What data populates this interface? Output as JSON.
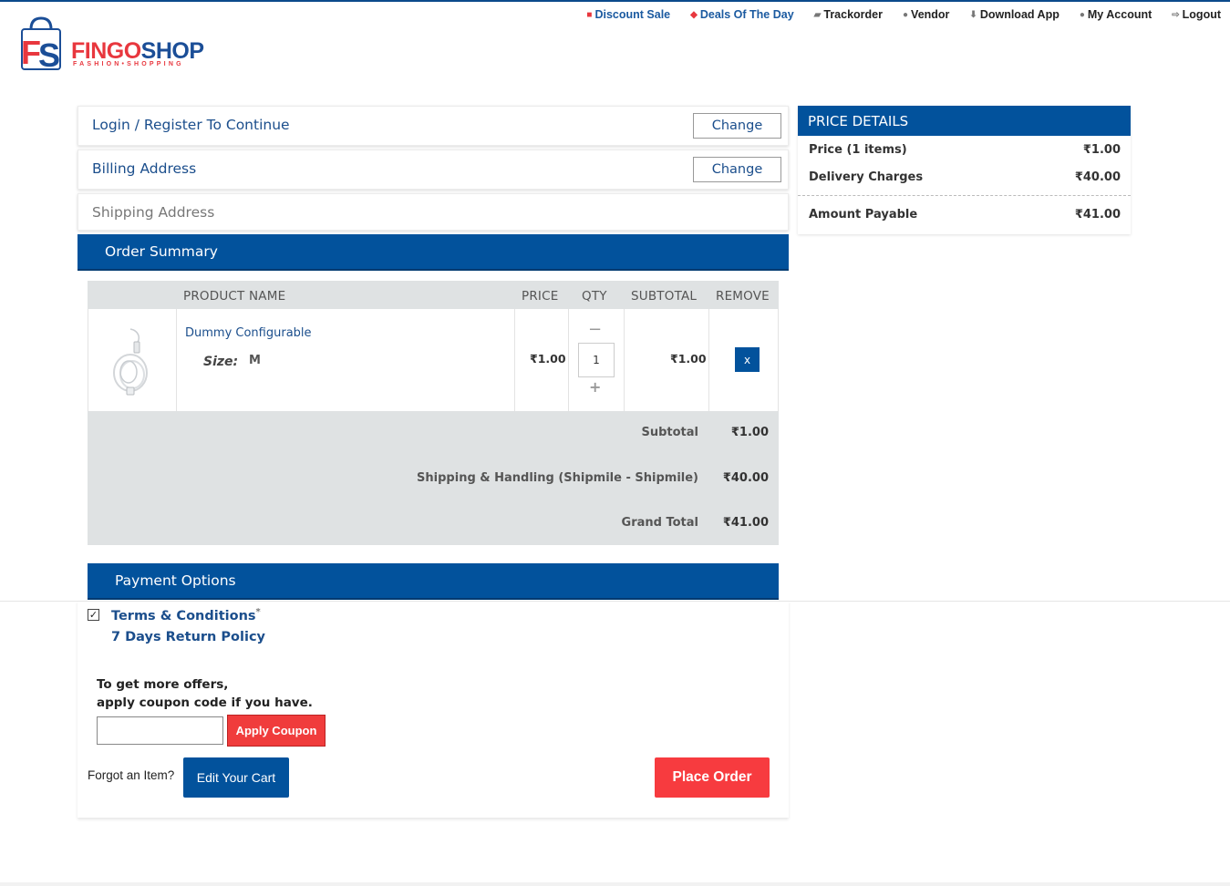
{
  "brand": {
    "name_part1": "FINGO",
    "name_part2": "SHOP",
    "tagline": "FASHION•SHOPPING",
    "monogram": "FS"
  },
  "topnav": [
    {
      "label": "Discount Sale",
      "icon": "gift-icon",
      "highlight": true
    },
    {
      "label": "Deals Of The Day",
      "icon": "tag-icon",
      "highlight": true
    },
    {
      "label": "Trackorder",
      "icon": "truck-icon",
      "highlight": false
    },
    {
      "label": "Vendor",
      "icon": "users-icon",
      "highlight": false
    },
    {
      "label": "Download App",
      "icon": "download-icon",
      "highlight": false
    },
    {
      "label": "My Account",
      "icon": "user-icon",
      "highlight": false
    },
    {
      "label": "Logout",
      "icon": "logout-icon",
      "highlight": false
    }
  ],
  "steps": {
    "login": {
      "title": "Login / Register To Continue",
      "button": "Change"
    },
    "billing": {
      "title": "Billing Address",
      "button": "Change"
    },
    "shipping": {
      "title": "Shipping Address"
    },
    "order_summary": "Order Summary",
    "payment_options": "Payment Options"
  },
  "table": {
    "headers": {
      "product_name": "PRODUCT NAME",
      "price": "PRICE",
      "qty": "QTY",
      "subtotal": "SUBTOTAL",
      "remove": "REMOVE"
    },
    "item": {
      "name": "Dummy Configurable",
      "size_label": "Size:",
      "size_value": "M",
      "price": "₹1.00",
      "qty": "1",
      "qty_minus": "−",
      "qty_plus": "+",
      "subtotal": "₹1.00",
      "remove": "x"
    },
    "totals": {
      "subtotal_label": "Subtotal",
      "subtotal_value": "₹1.00",
      "shipping_label": "Shipping & Handling (Shipmile - Shipmile)",
      "shipping_value": "₹40.00",
      "grand_label": "Grand Total",
      "grand_value": "₹41.00"
    }
  },
  "payment": {
    "terms": "Terms & Conditions",
    "terms_mark": "*",
    "terms_checked": true,
    "checkmark": "✓",
    "return_policy": "7 Days Return Policy",
    "offers_line1": "To get more offers,",
    "offers_line2": "apply coupon code if you have.",
    "coupon_value": "",
    "apply_button": "Apply Coupon",
    "forgot_text": "Forgot an Item?",
    "edit_button": "Edit Your Cart",
    "place_button": "Place Order"
  },
  "price_details": {
    "title": "PRICE DETAILS",
    "price_label": "Price (1 items)",
    "price_value": "₹1.00",
    "delivery_label": "Delivery Charges",
    "delivery_value": "₹40.00",
    "payable_label": "Amount Payable",
    "payable_value": "₹41.00"
  },
  "colors": {
    "primary_blue": "#02529c",
    "accent_red": "#f73b3f",
    "link_blue": "#1b4e8c",
    "table_grey": "#dfe2e3"
  }
}
